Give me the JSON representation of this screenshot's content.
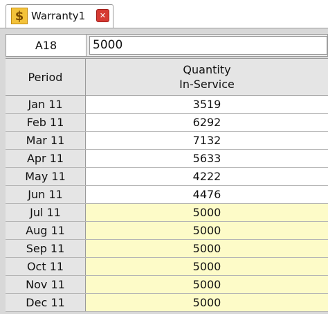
{
  "tab": {
    "icon": "dollar-sign-icon",
    "icon_glyph": "$",
    "label": "Warranty1",
    "close_icon": "close-icon",
    "close_glyph": "✕"
  },
  "cell_bar": {
    "reference": "A18",
    "value": "5000"
  },
  "table": {
    "headers": {
      "period": "Period",
      "quantity_line1": "Quantity",
      "quantity_line2": "In-Service"
    },
    "rows": [
      {
        "period": "Jan 11",
        "quantity": "3519",
        "highlight": false
      },
      {
        "period": "Feb 11",
        "quantity": "6292",
        "highlight": false
      },
      {
        "period": "Mar 11",
        "quantity": "7132",
        "highlight": false
      },
      {
        "period": "Apr 11",
        "quantity": "5633",
        "highlight": false
      },
      {
        "period": "May 11",
        "quantity": "4222",
        "highlight": false
      },
      {
        "period": "Jun 11",
        "quantity": "4476",
        "highlight": false
      },
      {
        "period": "Jul 11",
        "quantity": "5000",
        "highlight": true
      },
      {
        "period": "Aug 11",
        "quantity": "5000",
        "highlight": true
      },
      {
        "period": "Sep 11",
        "quantity": "5000",
        "highlight": true
      },
      {
        "period": "Oct 11",
        "quantity": "5000",
        "highlight": true
      },
      {
        "period": "Nov 11",
        "quantity": "5000",
        "highlight": true
      },
      {
        "period": "Dec 11",
        "quantity": "5000",
        "highlight": true
      }
    ]
  },
  "colors": {
    "highlight": "#fdfbc8",
    "header": "#e5e5e5",
    "tab_icon": "#f3c23a",
    "close": "#d63a33"
  }
}
